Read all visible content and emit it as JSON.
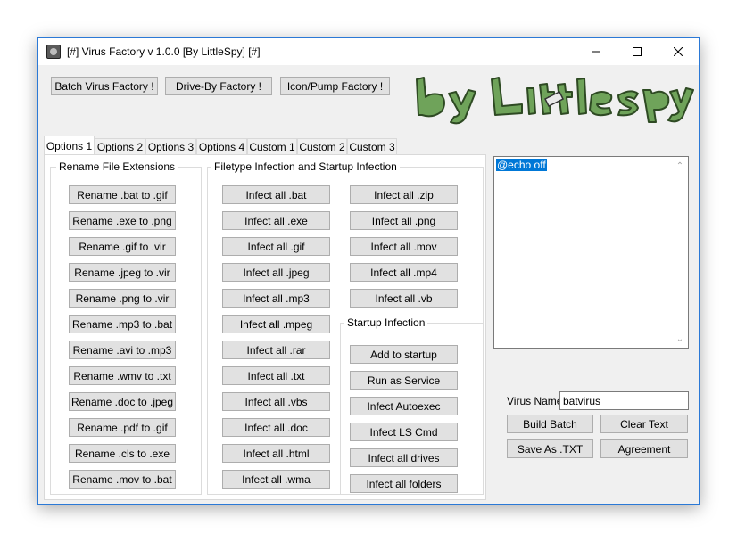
{
  "window": {
    "title": "[#] Virus Factory v 1.0.0 [By LittleSpy] [#]"
  },
  "top_buttons": [
    "Batch Virus Factory !",
    "Drive-By Factory !",
    "Icon/Pump Factory !"
  ],
  "logo_text": "by LittleSpy",
  "tabs": [
    "Options 1",
    "Options 2",
    "Options 3",
    "Options 4",
    "Custom 1",
    "Custom 2",
    "Custom 3"
  ],
  "rename_group": {
    "label": "Rename File Extensions",
    "buttons": [
      "Rename .bat to .gif",
      "Rename .exe to .png",
      "Rename .gif to .vir",
      "Rename .jpeg to .vir",
      "Rename .png to .vir",
      "Rename .mp3 to .bat",
      "Rename .avi to .mp3",
      "Rename .wmv to .txt",
      "Rename .doc to .jpeg",
      "Rename .pdf to .gif",
      "Rename .cls to .exe",
      "Rename .mov to .bat"
    ]
  },
  "infection_group": {
    "label": "Filetype Infection and Startup Infection",
    "col1": [
      "Infect all .bat",
      "Infect all .exe",
      "Infect all .gif",
      "Infect all .jpeg",
      "Infect all .mp3",
      "Infect all .mpeg",
      "Infect all .rar",
      "Infect all .txt",
      "Infect all .vbs",
      "Infect all .doc",
      "Infect all .html",
      "Infect all .wma"
    ],
    "col2": [
      "Infect all .zip",
      "Infect all .png",
      "Infect all .mov",
      "Infect all .mp4",
      "Infect all .vb"
    ]
  },
  "startup_group": {
    "label": "Startup Infection",
    "buttons": [
      "Add to startup",
      "Run as Service",
      "Infect Autoexec",
      "Infect LS Cmd",
      "Infect all drives",
      "Infect all folders"
    ]
  },
  "editor": {
    "content": "@echo off"
  },
  "virus_name": {
    "label": "Virus Name:",
    "value": "batvirus"
  },
  "action_buttons": {
    "build": "Build Batch",
    "clear": "Clear Text",
    "save": "Save As .TXT",
    "agreement": "Agreement"
  },
  "colors": {
    "accent_border": "#2b79d6",
    "selection": "#0078d7",
    "logo_fill": "#6fa35a"
  }
}
